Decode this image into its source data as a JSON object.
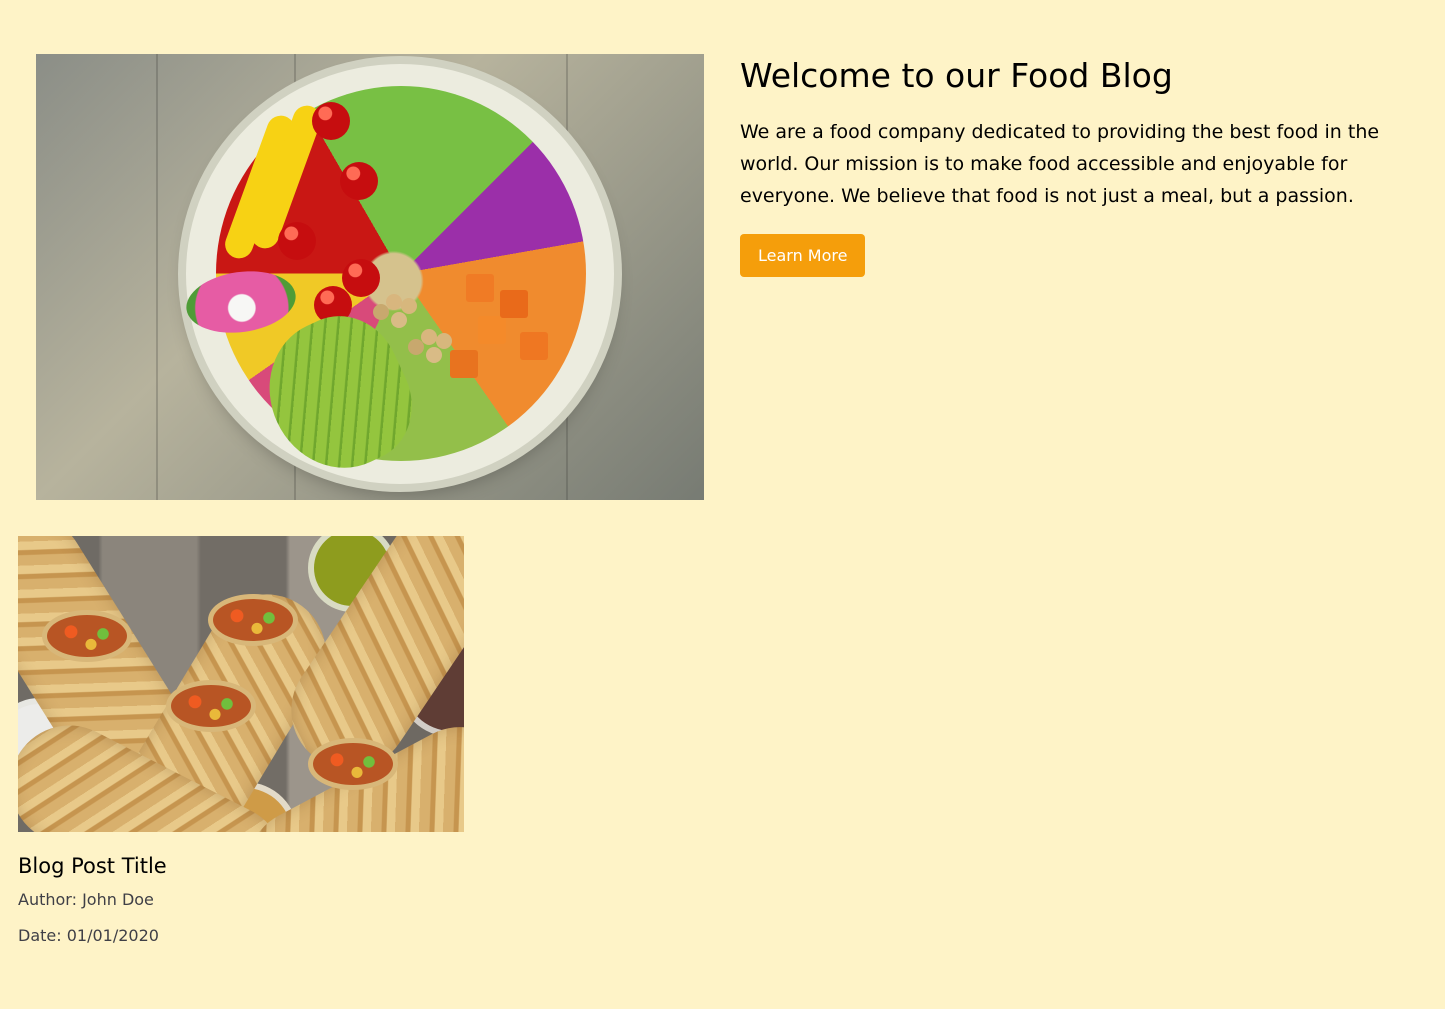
{
  "hero": {
    "image_alt": "Bowl with tomatoes, peppers, avocado, chickpeas, sweet potato, cabbage, and greens",
    "title": "Welcome to our Food Blog",
    "description": "We are a food company dedicated to providing the best food in the world. Our mission is to make food accessible and enjoyable for everyone. We believe that food is not just a meal, but a passion.",
    "button_label": "Learn More"
  },
  "blog_post": {
    "image_alt": "Burritos with dipping sauces",
    "title": "Blog Post Title",
    "author": "Author: John Doe",
    "date": "Date: 01/01/2020"
  },
  "colors": {
    "background": "#fef3c7",
    "button": "#f59e0b",
    "button_text": "#ffffff",
    "meta_text": "#3f3f46"
  }
}
